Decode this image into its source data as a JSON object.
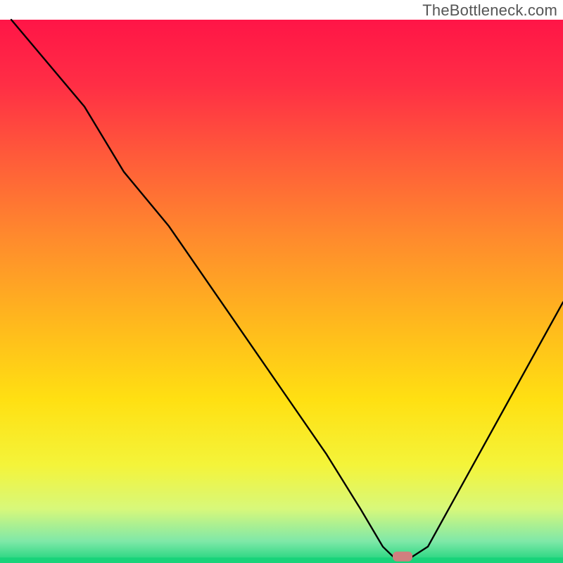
{
  "watermark": "TheBottleneck.com",
  "chart_data": {
    "type": "line",
    "title": "",
    "xlabel": "",
    "ylabel": "",
    "xlim": [
      0,
      100
    ],
    "ylim": [
      0,
      100
    ],
    "grid": false,
    "legend": false,
    "gradient_stops": [
      {
        "offset": 0.0,
        "color": "#ff1547"
      },
      {
        "offset": 0.12,
        "color": "#ff2e45"
      },
      {
        "offset": 0.25,
        "color": "#ff5a3a"
      },
      {
        "offset": 0.4,
        "color": "#ff8a2d"
      },
      {
        "offset": 0.55,
        "color": "#ffb61e"
      },
      {
        "offset": 0.7,
        "color": "#ffe012"
      },
      {
        "offset": 0.82,
        "color": "#f4f43a"
      },
      {
        "offset": 0.9,
        "color": "#d8f87a"
      },
      {
        "offset": 0.96,
        "color": "#7fe8a8"
      },
      {
        "offset": 1.0,
        "color": "#18d37a"
      }
    ],
    "series": [
      {
        "name": "bottleneck-curve",
        "color": "#000000",
        "x": [
          2,
          15,
          22,
          30,
          40,
          50,
          58,
          64,
          68,
          70,
          73,
          76,
          100
        ],
        "y": [
          100,
          84,
          72,
          62,
          47,
          32,
          20,
          10,
          3,
          1,
          1,
          3,
          48
        ]
      }
    ],
    "marker": {
      "name": "optimal-point",
      "x": 71.5,
      "y": 1.2,
      "width_x": 3.5,
      "height_y": 1.8,
      "color": "#d07f7f"
    },
    "bottom_band": {
      "color": "#18d37a",
      "y_start": 0,
      "y_end": 1
    }
  }
}
